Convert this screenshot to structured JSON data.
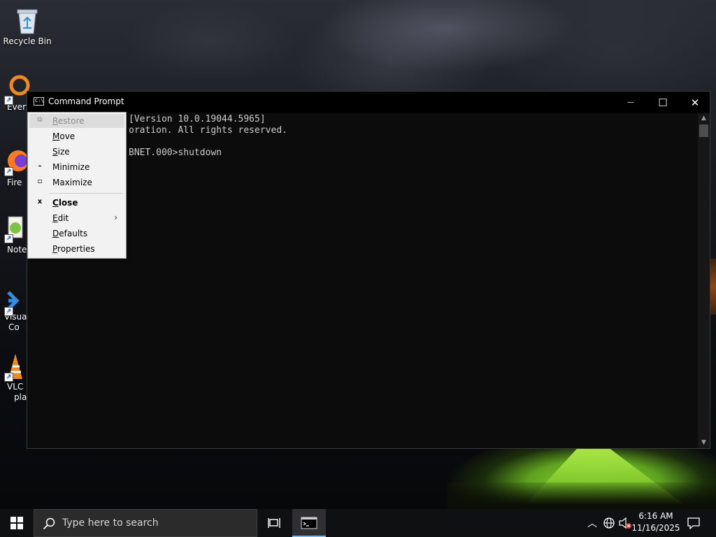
{
  "desktop": {
    "icons": [
      {
        "label": "Recycle Bin",
        "icon": "recycle-bin-icon"
      },
      {
        "label": "Every",
        "icon": "everything-icon"
      },
      {
        "label": "Fire",
        "icon": "firefox-icon"
      },
      {
        "label": "Notep",
        "icon": "notepad-plus-plus-icon"
      },
      {
        "label": "Visual",
        "label2": "Co",
        "icon": "vscode-icon"
      },
      {
        "label": "VLC r",
        "label2": "pla",
        "icon": "vlc-icon"
      }
    ]
  },
  "cmd": {
    "title": "Command Prompt",
    "lines": [
      "[Version 10.0.19044.5965]",
      "oration. All rights reserved.",
      "",
      "BNET.000>shutdown"
    ],
    "controls": {
      "minimize": "—",
      "maximize": "☐",
      "close": "✕"
    }
  },
  "system_menu": {
    "items": [
      {
        "label": "Restore",
        "icon": "restore-icon",
        "state": "disabled"
      },
      {
        "label": "Move"
      },
      {
        "label": "Size"
      },
      {
        "label": "Minimize",
        "icon": "minimize-icon"
      },
      {
        "label": "Maximize",
        "icon": "maximize-icon"
      },
      {
        "label": "Close",
        "icon": "close-icon",
        "bold": true
      },
      {
        "label": "Edit",
        "submenu": true
      },
      {
        "label": "Defaults"
      },
      {
        "label": "Properties"
      }
    ]
  },
  "taskbar": {
    "search_placeholder": "Type here to search",
    "clock_time": "6:16 AM",
    "clock_date": "11/16/2025"
  },
  "colors": {
    "cmd_bg": "#0c0c0c",
    "cmd_text": "#cccccc",
    "taskbar_bg": "#0f1012",
    "menu_bg": "#f2f2f2",
    "active_accent": "#76b9ed"
  }
}
